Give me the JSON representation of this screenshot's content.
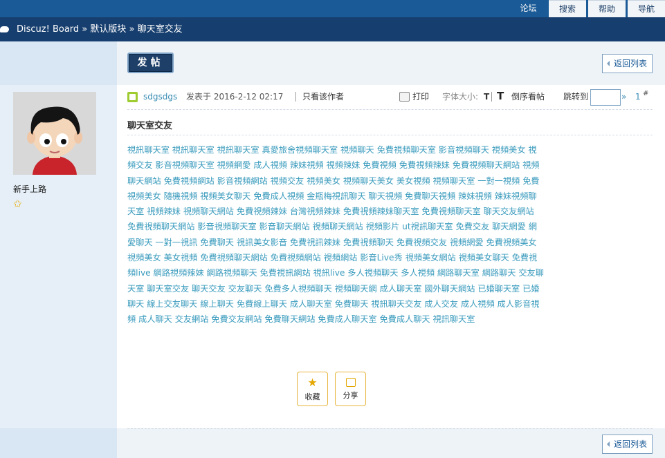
{
  "topnav": {
    "forum": "论坛",
    "search": "搜索",
    "help": "帮助",
    "guide": "导航"
  },
  "breadcrumb": {
    "text": "Discuz! Board » 默认版块 » 聊天室交友"
  },
  "toolbar": {
    "post_label": "发帖",
    "back_label": "返回列表"
  },
  "author": {
    "name": "sdgsdgs",
    "level": "新手上路",
    "avatar": "cartoon-boy-avatar"
  },
  "post": {
    "posted_prefix": "发表于",
    "posted_at": "2016-2-12 02:17",
    "only_author": "只看该作者",
    "print": "打印",
    "font_size": "字体大小:",
    "font_glyph": "T",
    "font_glyph_big": "T",
    "reverse": "倒序看帖",
    "jump_to": "跳转到",
    "jump_arrow": "»",
    "floor_num": "1",
    "floor_hash": "#",
    "title": "聊天室交友",
    "body": "視訊聊天室 視訊聊天室 視訊聊天室 真愛旅舍視頻聊天室 視頻聊天 免費視頻聊天室 影音視頻聊天 視頻美女 視頻交友 影音視頻聊天室 視頻網愛 成人視頻 辣妹視頻 視頻辣妹 免費視頻 免費視頻辣妹 免費視頻聊天網站 視頻聊天網站 免費視頻網站 影音視頻網站 視頻交友 視頻美女 視頻聊天美女 美女視頻 視頻聊天室 一對一視頻 免費視頻美女 隨機視頻 視頻美女聊天 免費成人視頻 金瓶梅視訊聊天 聊天視頻 免費聊天視頻 辣妹視頻 辣妹視頻聊天室 視頻辣妹 視頻聊天網站 免費視頻辣妹 台灣視頻辣妹 免費視頻辣妹聊天室 免費視頻聊天室 聊天交友網站 免費視頻聊天網站 影音視頻聊天室 影音聊天網站 視頻聊天網站 視頻影片 ut視訊聊天室 免費交友 聊天網愛 網愛聊天 一對一視訊 免費聊天 視訊美女影音 免費視訊辣妹 免費視頻聊天 免費視頻交友 視頻網愛 免費視頻美女 視頻美女 美女視頻 免費視頻聊天網站 免費視頻網站 視頻網站 影音Live秀 視頻美女網站 視頻美女聊天 免費視頻live 網路視頻辣妹 網路視頻聊天 免費視訊網站 視訊live 多人視頻聊天 多人視頻 網路聊天室 網路聊天 交友聊天室 聊天室交友 聊天交友 交友聊天 免費多人視頻聊天 視頻聊天網 成人聊天室 國外聊天網站 已婚聊天室 已婚聊天 線上交友聊天 線上聊天 免費線上聊天 成人聊天室 免費聊天 視訊聊天交友 成人交友 成人視頻 成人影音視頻 成人聊天 交友網站 免費交友網站 免費聊天網站 免費成人聊天室 免費成人聊天 視訊聊天室",
    "favorite": "收藏",
    "share": "分享"
  },
  "colors": {
    "topbar": "#1a5a96",
    "crumbbar": "#163e6e",
    "link": "#3a9bbd",
    "accent": "#e4a700"
  }
}
